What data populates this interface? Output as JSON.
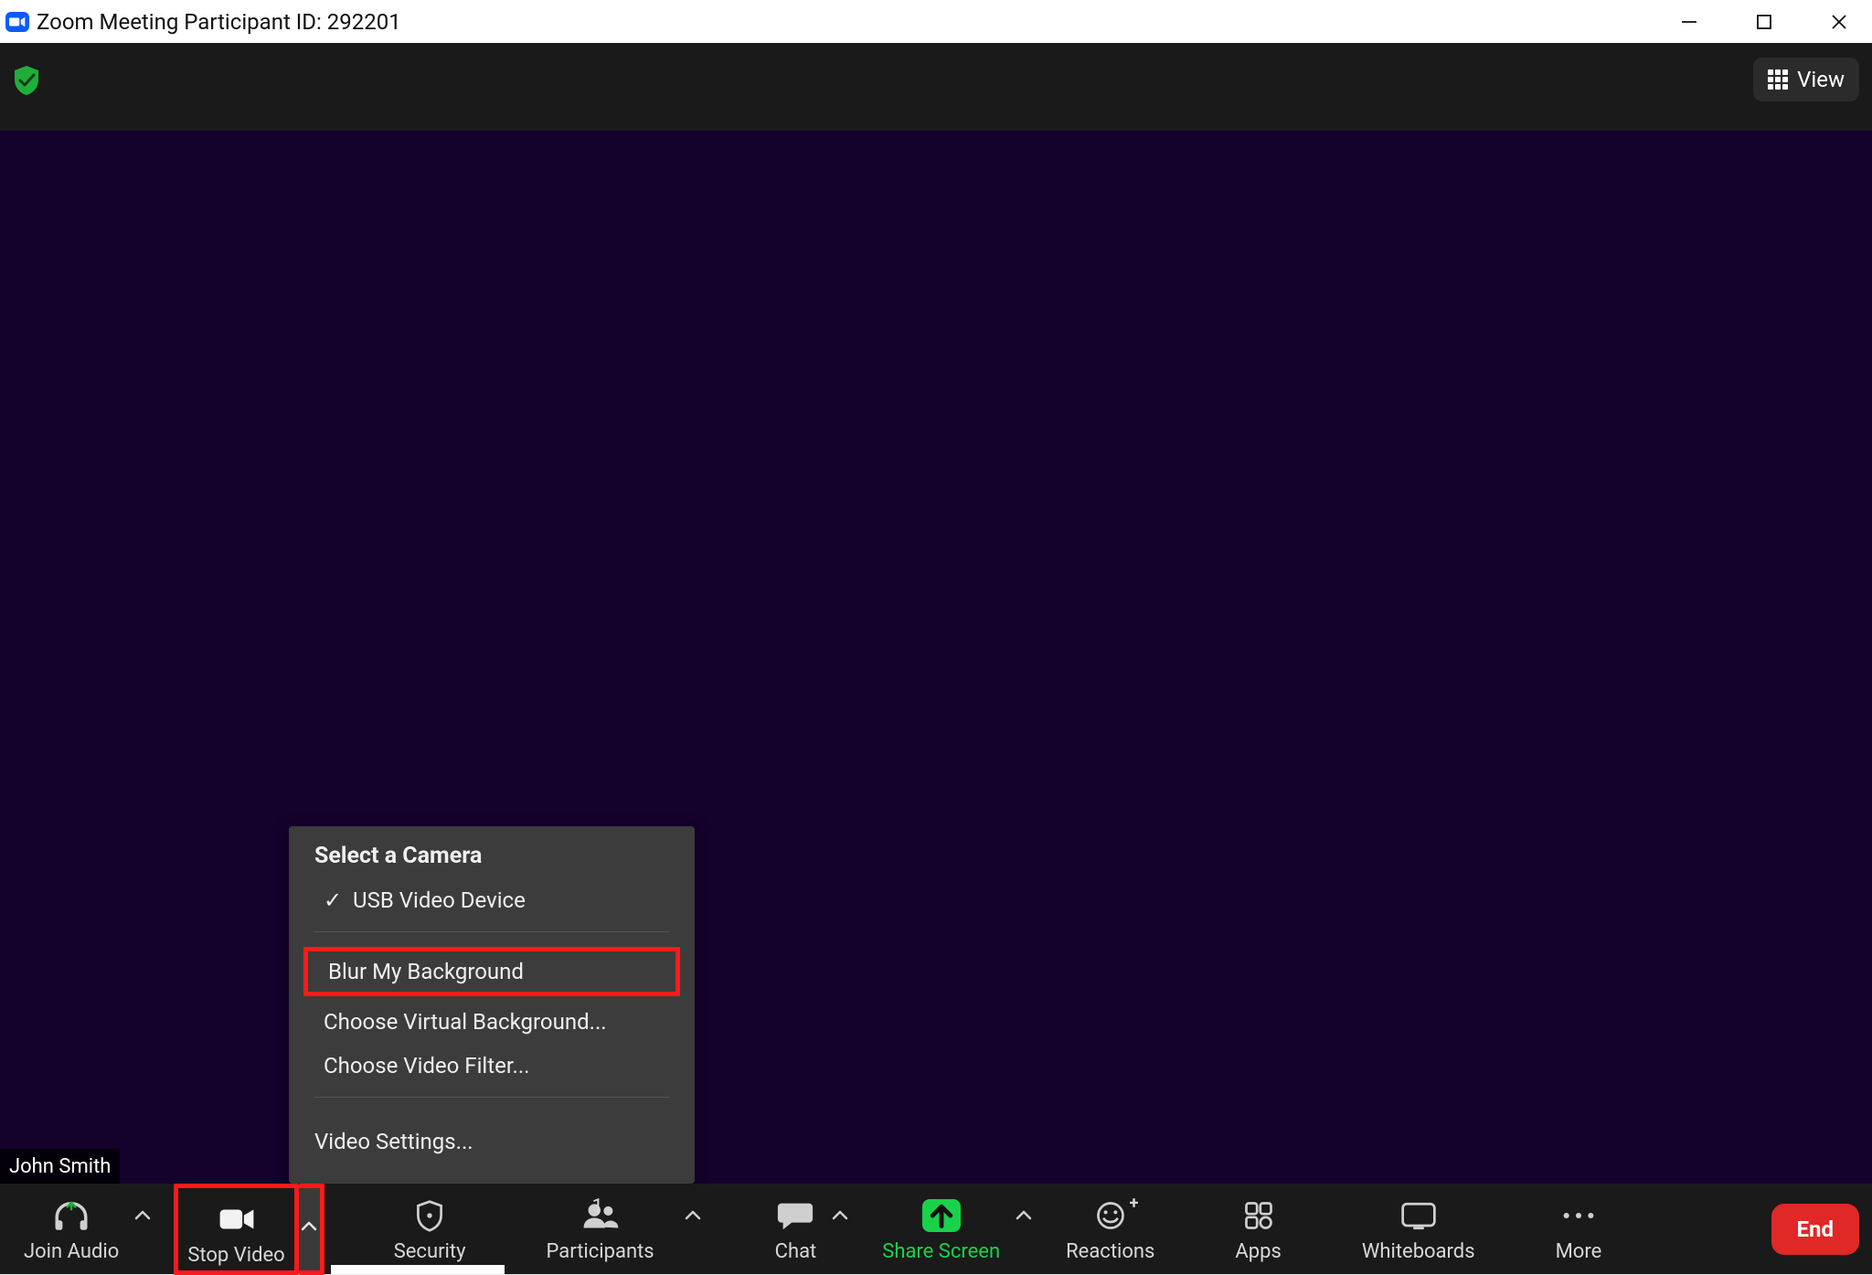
{
  "titlebar": {
    "text": "Zoom Meeting Participant ID: 292201"
  },
  "topstrip": {
    "view_label": "View"
  },
  "video": {
    "participant_name": "John Smith"
  },
  "popup": {
    "header": "Select a Camera",
    "camera_selected": "USB Video Device",
    "blur": "Blur My Background",
    "virtual_bg": "Choose Virtual Background...",
    "video_filter": "Choose Video Filter...",
    "video_settings": "Video Settings..."
  },
  "toolbar": {
    "join_audio": "Join Audio",
    "stop_video": "Stop Video",
    "security": "Security",
    "participants": "Participants",
    "participants_count": "1",
    "chat": "Chat",
    "share_screen": "Share Screen",
    "reactions": "Reactions",
    "apps": "Apps",
    "whiteboards": "Whiteboards",
    "more": "More",
    "end": "End"
  }
}
